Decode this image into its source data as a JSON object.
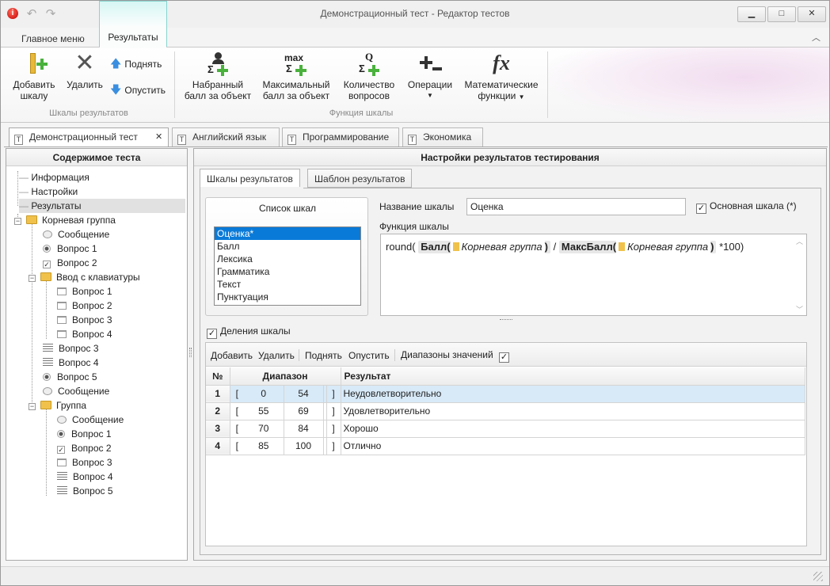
{
  "window": {
    "title": "Демонстрационный тест - Редактор тестов",
    "buttons": {
      "minimize": "▁",
      "maximize": "□",
      "close": "✕"
    }
  },
  "menu": {
    "main": "Главное меню",
    "results": "Результаты"
  },
  "ribbon": {
    "group1_label": "Шкалы результатов",
    "group2_label": "Функция шкалы",
    "add_line1": "Добавить",
    "add_line2": "шкалу",
    "delete": "Удалить",
    "up": "Поднять",
    "down": "Опустить",
    "scored_line1": "Набранный",
    "scored_line2": "балл за объект",
    "max_line1": "Максимальный",
    "max_line2": "балл за объект",
    "count_line1": "Количество",
    "count_line2": "вопросов",
    "ops_line1": "Операции",
    "math_line1": "Математические",
    "math_line2": "функции",
    "max_glyph": "max",
    "q_glyph": "Q",
    "fx_glyph": "fx",
    "sigma_glyph": "Σ"
  },
  "doc_tabs": [
    {
      "label": "Демонстрационный тест"
    },
    {
      "label": "Английский язык"
    },
    {
      "label": "Программирование"
    },
    {
      "label": "Экономика"
    }
  ],
  "tab_close": "✕",
  "left_panel": {
    "title": "Содержимое теста",
    "items": [
      "Информация",
      "Настройки",
      "Результаты",
      "Корневая группа",
      "Сообщение",
      "Вопрос 1",
      "Вопрос 2",
      "Ввод с клавиатуры",
      "Вопрос 1",
      "Вопрос 2",
      "Вопрос 3",
      "Вопрос 4",
      "Вопрос 3",
      "Вопрос 4",
      "Вопрос 5",
      "Сообщение",
      "Группа",
      "Сообщение",
      "Вопрос 1",
      "Вопрос 2",
      "Вопрос 3",
      "Вопрос 4",
      "Вопрос 5"
    ]
  },
  "right_panel": {
    "title": "Настройки результатов тестирования",
    "tabs": [
      "Шкалы результатов",
      "Шаблон результатов"
    ],
    "scale_list_title": "Список шкал",
    "scales": [
      "Оценка*",
      "Балл",
      "Лексика",
      "Грамматика",
      "Текст",
      "Пунктуация"
    ],
    "scale_name_label": "Название шкалы",
    "scale_name_value": "Оценка",
    "main_scale_label": "Основная шкала (*)",
    "function_label": "Функция шкалы",
    "formula": {
      "open": "round(",
      "token1": "Балл(",
      "token1_arg": "Корневая группа",
      "token1_close": ")",
      "div": "/",
      "token2": "МаксБалл(",
      "token2_arg": "Корневая группа",
      "token2_close": ")",
      "tail": "*100)"
    },
    "divisions_label": "Деления шкалы",
    "toolbar": {
      "add": "Добавить",
      "delete": "Удалить",
      "up": "Поднять",
      "down": "Опустить",
      "ranges": "Диапазоны значений"
    },
    "table": {
      "headers": {
        "num": "№",
        "range": "Диапазон",
        "result": "Результат"
      },
      "rows": [
        {
          "num": "1",
          "lb": "[",
          "from": "0",
          "to": "54",
          "rb": "]",
          "result": "Неудовлетворительно"
        },
        {
          "num": "2",
          "lb": "[",
          "from": "55",
          "to": "69",
          "rb": "]",
          "result": "Удовлетворительно"
        },
        {
          "num": "3",
          "lb": "[",
          "from": "70",
          "to": "84",
          "rb": "]",
          "result": "Хорошо"
        },
        {
          "num": "4",
          "lb": "[",
          "from": "85",
          "to": "100",
          "rb": "]",
          "result": "Отлично"
        }
      ]
    }
  },
  "colors": {
    "accent": "#0a7ad8",
    "ribbon_tab": "#86d4cf",
    "folder": "#f0c24b"
  }
}
